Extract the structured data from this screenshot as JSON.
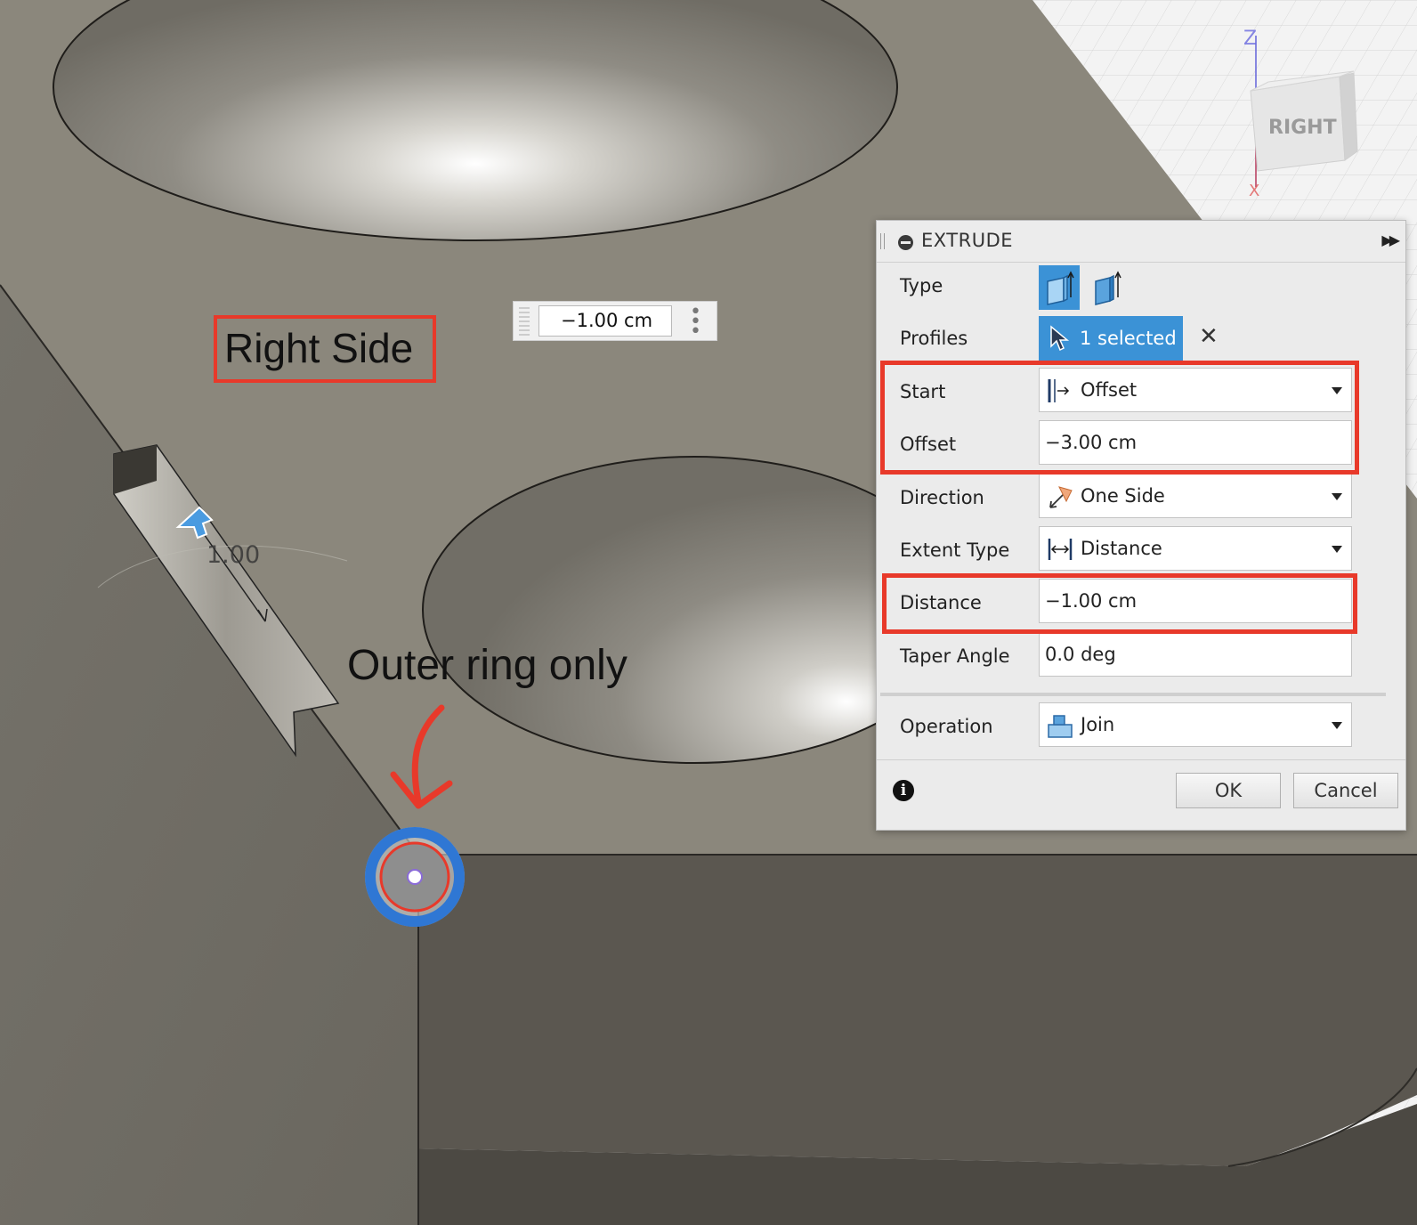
{
  "viewport": {
    "floating_input_value": "−1.00 cm",
    "dimension_text": "1.00",
    "viewcube_face": "RIGHT",
    "viewcube_axis_z": "Z",
    "viewcube_axis_x": "X",
    "annotation_right_side": "Right Side",
    "annotation_outer_ring": "Outer ring only"
  },
  "colors": {
    "accent_blue": "#3b92d6",
    "annotation_red": "#e8392a",
    "model_surface": "#8b877c"
  },
  "panel": {
    "title": "EXTRUDE",
    "rows": {
      "type": {
        "label": "Type",
        "icons": [
          "extrude-solid-icon",
          "extrude-surface-icon"
        ]
      },
      "profiles": {
        "label": "Profiles",
        "value": "1 selected",
        "icon": "select-cursor-icon"
      },
      "start": {
        "label": "Start",
        "value": "Offset",
        "icon": "offset-start-icon"
      },
      "offset": {
        "label": "Offset",
        "value": "−3.00 cm"
      },
      "direction": {
        "label": "Direction",
        "value": "One Side",
        "icon": "one-side-direction-icon"
      },
      "extent_type": {
        "label": "Extent Type",
        "value": "Distance",
        "icon": "distance-extent-icon"
      },
      "distance": {
        "label": "Distance",
        "value": "−1.00 cm"
      },
      "taper_angle": {
        "label": "Taper Angle",
        "value": "0.0 deg"
      },
      "operation": {
        "label": "Operation",
        "value": "Join",
        "icon": "join-operation-icon"
      }
    },
    "buttons": {
      "ok": "OK",
      "cancel": "Cancel"
    }
  }
}
